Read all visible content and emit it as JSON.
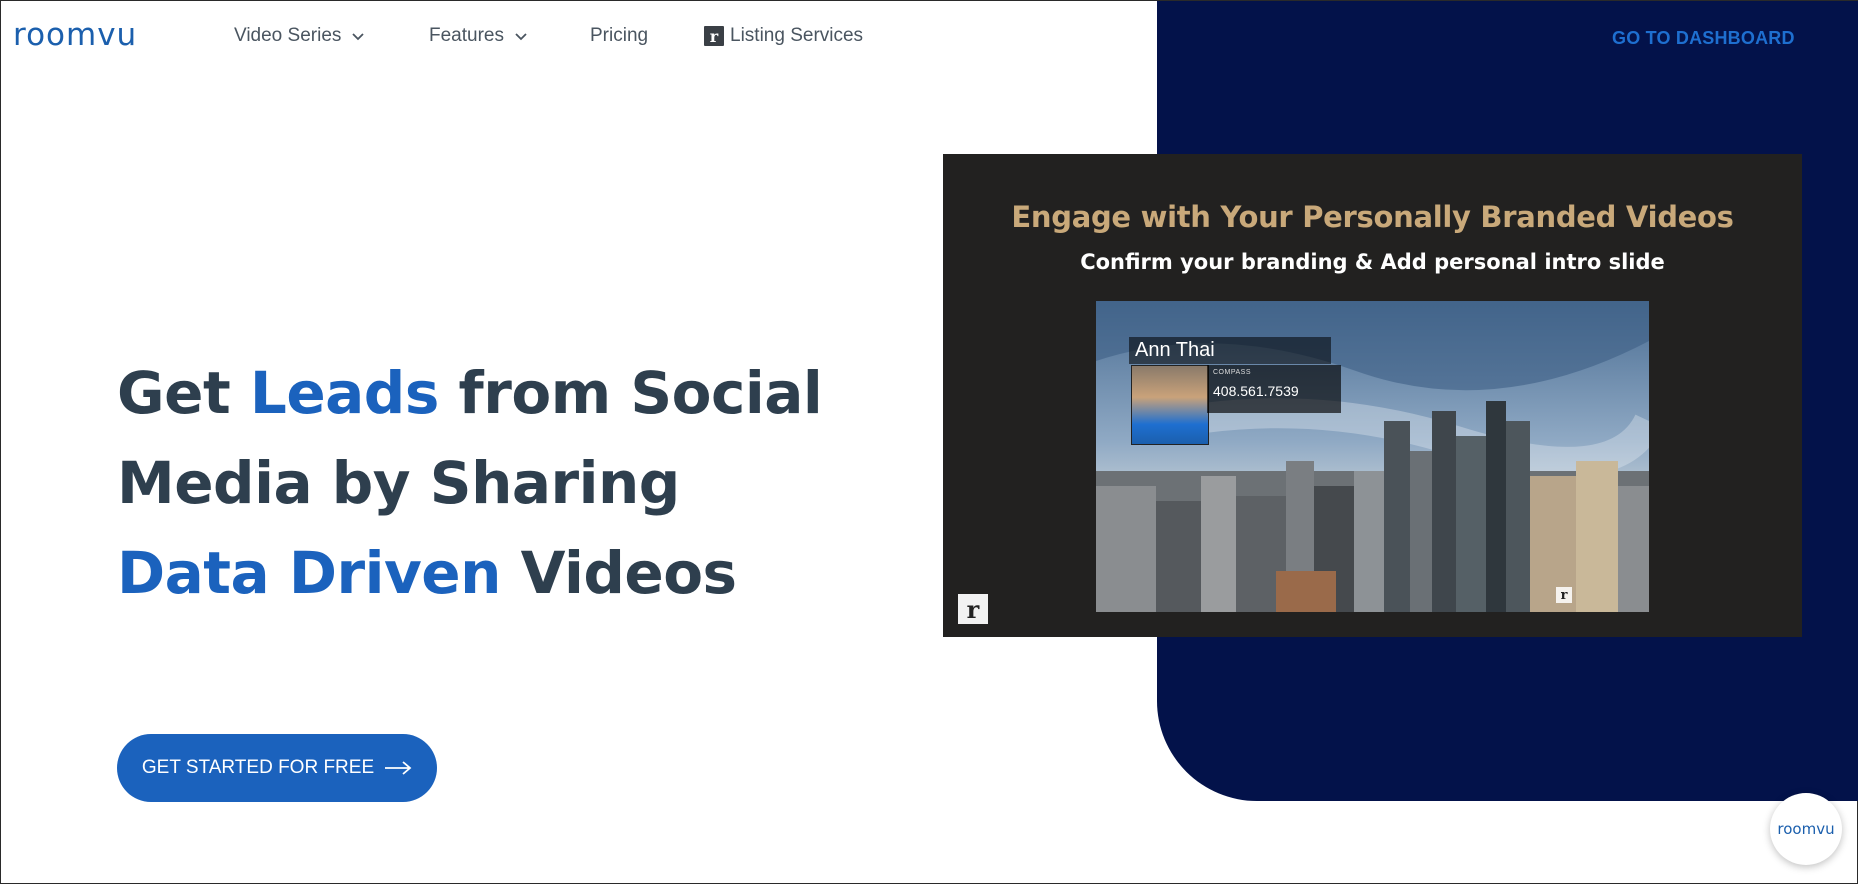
{
  "brand": {
    "logo_text": "roomvu",
    "accent": "#1b62bd",
    "navy": "#03124a"
  },
  "nav": {
    "items": [
      {
        "label": "Video Series",
        "icon": "chevron-down-icon"
      },
      {
        "label": "Features",
        "icon": "chevron-down-icon"
      },
      {
        "label": "Pricing"
      },
      {
        "label": "Listing Services",
        "icon": "roomvu-r-icon"
      }
    ],
    "dashboard_label": "GO TO DASHBOARD"
  },
  "hero": {
    "parts": [
      {
        "text": "Get ",
        "highlight": false
      },
      {
        "text": "Leads",
        "highlight": true
      },
      {
        "text": " from Social Media by Sharing ",
        "highlight": false
      },
      {
        "text": "Data Driven",
        "highlight": true
      },
      {
        "text": " Videos",
        "highlight": false
      }
    ],
    "cta_label": "GET STARTED FOR FREE"
  },
  "video": {
    "title": "Engage with Your Personally Branded Videos",
    "subtitle": "Confirm your branding & Add personal intro slide",
    "agent_name": "Ann Thai",
    "agent_company": "COMPASS",
    "agent_phone": "408.561.7539",
    "mark": "r"
  },
  "badge": {
    "label": "roomvu"
  }
}
